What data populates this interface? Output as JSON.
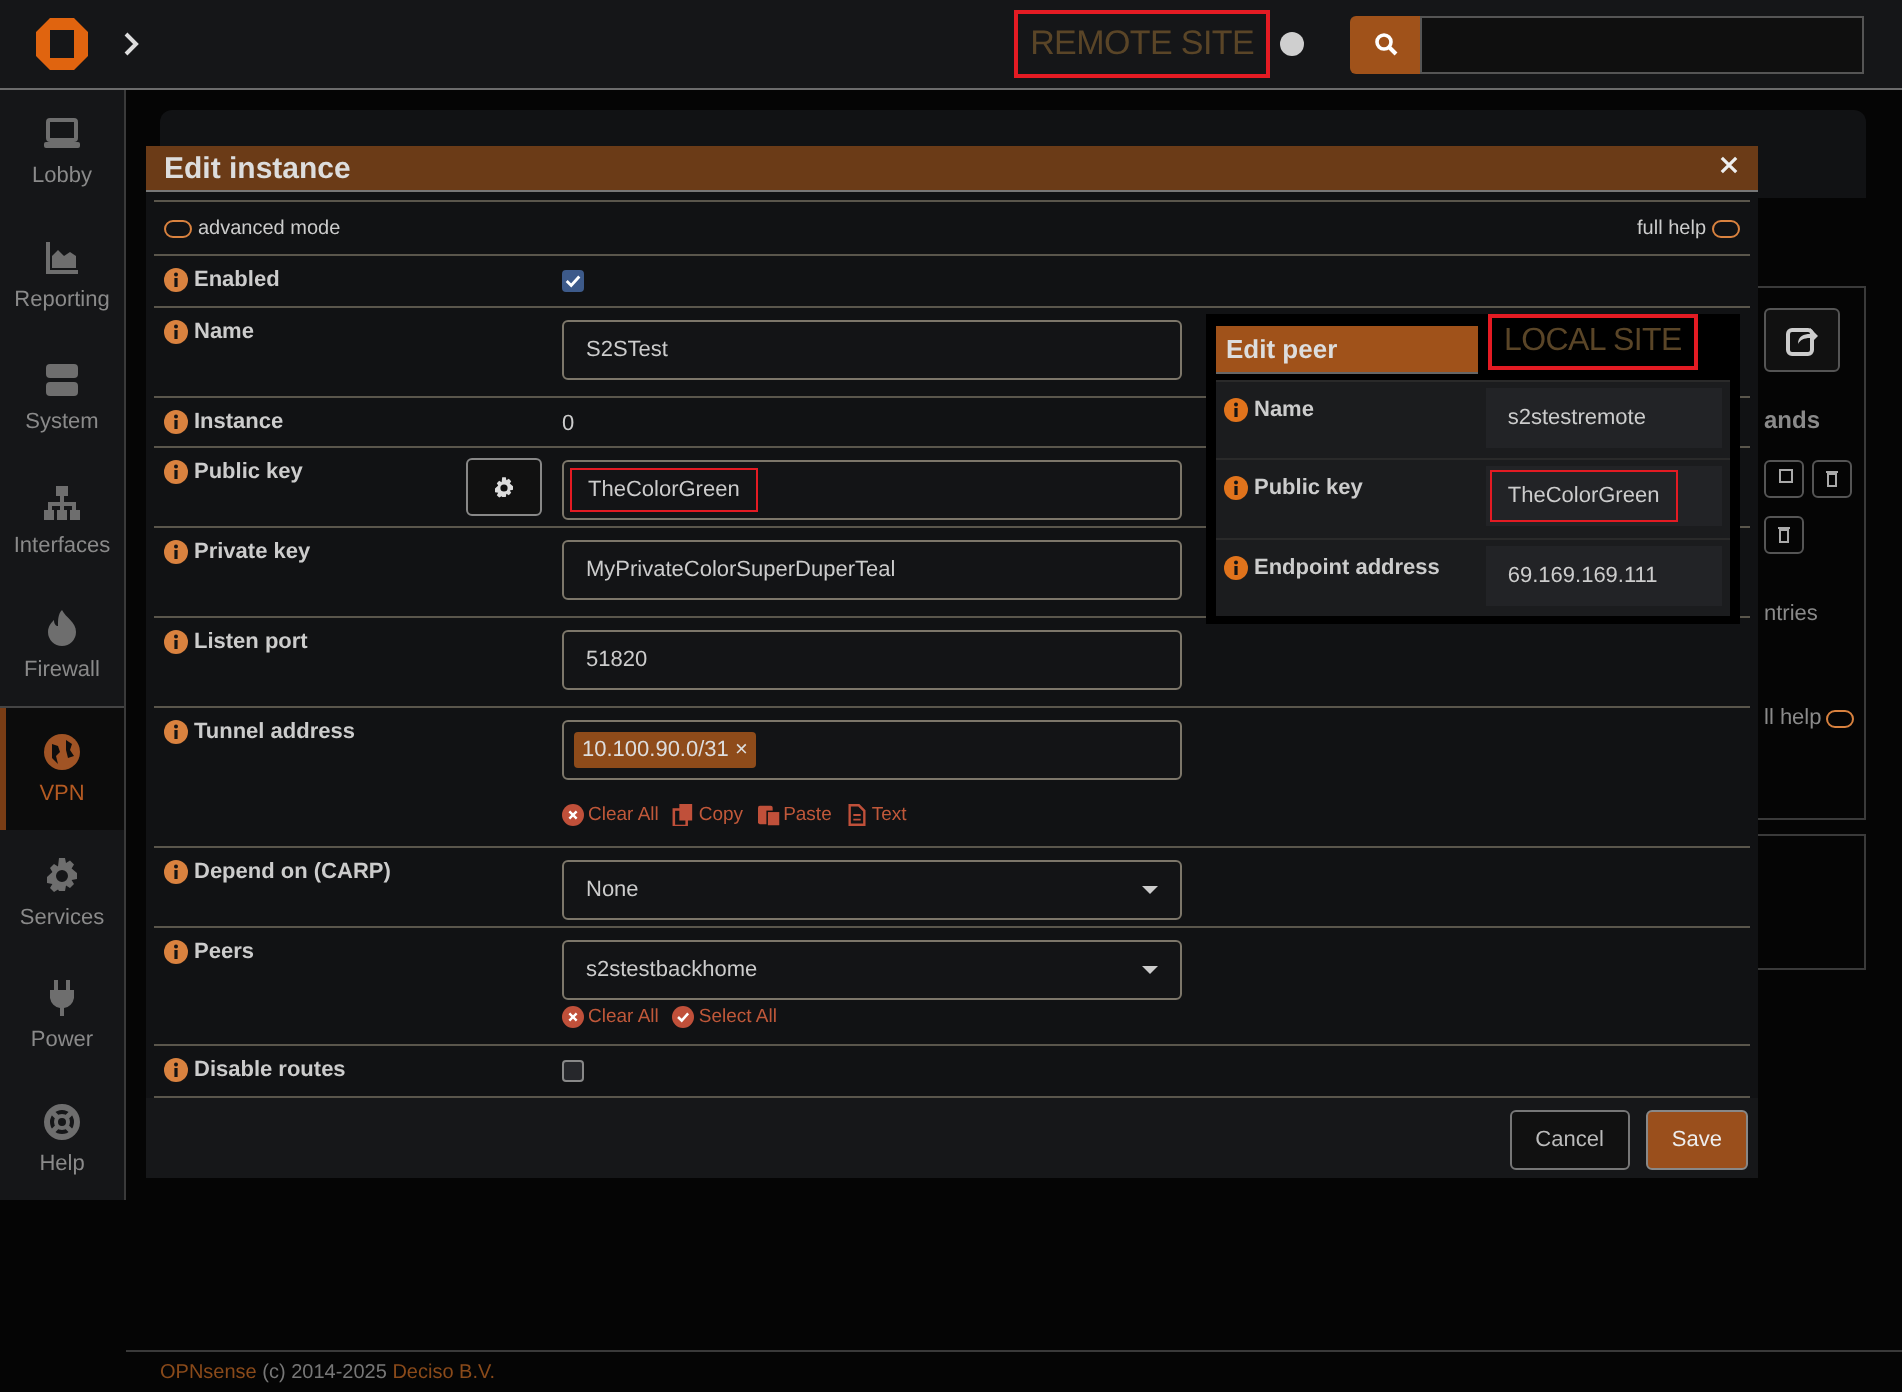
{
  "topbar": {
    "site_label": "REMOTE SITE",
    "status_on": false
  },
  "sidebar": {
    "items": [
      {
        "label": "Lobby",
        "selected": false
      },
      {
        "label": "Reporting",
        "selected": false
      },
      {
        "label": "System",
        "selected": false
      },
      {
        "label": "Interfaces",
        "selected": false
      },
      {
        "label": "Firewall",
        "selected": false
      },
      {
        "label": "VPN",
        "selected": true
      },
      {
        "label": "Services",
        "selected": false
      },
      {
        "label": "Power",
        "selected": false
      },
      {
        "label": "Help",
        "selected": false
      }
    ]
  },
  "background": {
    "column_heading": "ands",
    "entries_text": "ntries",
    "help_label": "ll help",
    "help_on": false
  },
  "modal": {
    "title": "Edit instance",
    "advanced_mode": {
      "label": "advanced mode",
      "on": false
    },
    "full_help": {
      "label": "full help",
      "on": false
    },
    "fields": [
      {
        "kind": "checkbox",
        "label": "Enabled",
        "checked": true
      },
      {
        "kind": "text",
        "label": "Name",
        "value": "S2STest"
      },
      {
        "kind": "static",
        "label": "Instance",
        "value": "0"
      },
      {
        "kind": "key",
        "label": "Public key",
        "value": "TheColorGreen",
        "highlighted": true
      },
      {
        "kind": "text",
        "label": "Private key",
        "value": "MyPrivateColorSuperDuperTeal"
      },
      {
        "kind": "text",
        "label": "Listen port",
        "value": "51820"
      },
      {
        "kind": "tags",
        "label": "Tunnel address",
        "tags": [
          {
            "label": "10.100.90.0/31",
            "remove": "×"
          }
        ],
        "actions": [
          {
            "kind": "clear",
            "label": "Clear All"
          },
          {
            "kind": "copy",
            "label": "Copy"
          },
          {
            "kind": "paste",
            "label": "Paste"
          },
          {
            "kind": "text",
            "label": "Text"
          }
        ]
      },
      {
        "kind": "select",
        "label": "Depend on (CARP)",
        "value": "None"
      },
      {
        "kind": "select",
        "label": "Peers",
        "value": "s2stestbackhome",
        "actions": [
          {
            "kind": "clear",
            "label": "Clear All"
          },
          {
            "kind": "select",
            "label": "Select All"
          }
        ]
      },
      {
        "kind": "checkbox",
        "label": "Disable routes",
        "checked": false
      }
    ],
    "buttons": [
      {
        "kind": "default",
        "label": "Cancel"
      },
      {
        "kind": "primary",
        "label": "Save"
      }
    ]
  },
  "peer": {
    "title": "Edit peer",
    "site_label": "LOCAL SITE",
    "fields": [
      {
        "label": "Name",
        "value": "s2stestremote",
        "highlighted": false
      },
      {
        "label": "Public key",
        "value": "TheColorGreen",
        "highlighted": true
      },
      {
        "label": "Endpoint address",
        "value": "69.169.169.111",
        "highlighted": false
      }
    ]
  },
  "footer": {
    "brand": "OPNsense",
    "text": "(c) 2014-2025",
    "company": "Deciso B.V."
  }
}
